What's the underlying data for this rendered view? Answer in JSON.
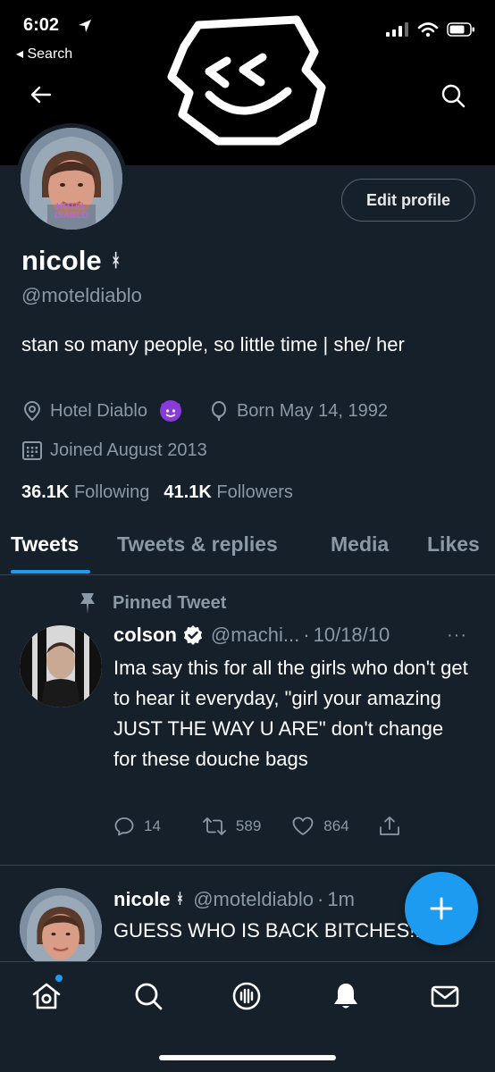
{
  "status_bar": {
    "time": "6:02",
    "back_label": "◂ Search"
  },
  "profile": {
    "display_name": "nicole",
    "name_mark": "ᚼ",
    "handle": "@moteldiablo",
    "bio": "stan so many people, so little time | she/ her",
    "location": "Hotel Diablo",
    "birthday": "Born May 14, 1992",
    "joined": "Joined August 2013",
    "following_count": "36.1K",
    "following_label": "Following",
    "followers_count": "41.1K",
    "followers_label": "Followers",
    "avatar_text": "HOTEL DIABLO",
    "edit_button": "Edit profile"
  },
  "tabs": [
    {
      "label": "Tweets",
      "active": true
    },
    {
      "label": "Tweets & replies",
      "active": false
    },
    {
      "label": "Media",
      "active": false
    },
    {
      "label": "Likes",
      "active": false
    }
  ],
  "tweets": [
    {
      "pinned_label": "Pinned Tweet",
      "author": "colson",
      "verified": true,
      "handle": "@machi...",
      "separator": "·",
      "date": "10/18/10",
      "more": "···",
      "text": "Ima say this for all the girls who don't get to hear it everyday, \"girl your amazing JUST THE WAY U ARE\" don't change for these douche bags",
      "replies": "14",
      "retweets": "589",
      "likes": "864"
    },
    {
      "author": "nicole",
      "name_mark": "ᚼ",
      "handle": "@moteldiablo",
      "separator": "·",
      "date": "1m",
      "text": "GUESS WHO IS BACK BITCHES!!!"
    }
  ],
  "colors": {
    "background": "#15202b",
    "accent": "#1d9bf0",
    "muted": "#8b98a5",
    "divider": "#38444d"
  },
  "icons": {
    "back": "arrow-left-icon",
    "search": "search-icon",
    "location": "location-pin-icon",
    "birthday": "balloon-icon",
    "calendar": "calendar-icon",
    "pin": "pin-icon",
    "verified": "verified-badge-icon",
    "reply": "reply-icon",
    "retweet": "retweet-icon",
    "like": "heart-icon",
    "share": "share-icon",
    "compose": "plus-icon",
    "nav": [
      "home-icon",
      "explore-icon",
      "spaces-icon",
      "notifications-icon",
      "messages-icon"
    ]
  }
}
